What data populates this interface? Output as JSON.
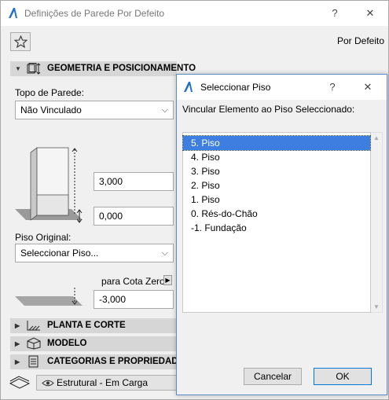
{
  "main": {
    "title": "Definições de Parede Por Defeito",
    "help": "?",
    "close": "✕",
    "favorites_icon": "star-icon",
    "defaults_label": "Por Defeito",
    "geometry": {
      "header": "GEOMETRIA E POSICIONAMENTO",
      "top_label": "Topo de Parede:",
      "top_value": "Não Vinculado",
      "height_value": "3,000",
      "offset_value": "0,000",
      "home_story_label": "Piso Original:",
      "home_story_value": "Seleccionar Piso...",
      "zero_ref_label": "para Cota Zero",
      "base_offset_value": "-3,000"
    },
    "sections": [
      {
        "label": "PLANTA E CORTE",
        "icon": "floor-plan-icon"
      },
      {
        "label": "MODELO",
        "icon": "model-cube-icon"
      },
      {
        "label": "CATEGORIAS E PROPRIEDADES",
        "icon": "properties-list-icon"
      }
    ],
    "layer_value": "Estrutural - Em Carga"
  },
  "dialog": {
    "title": "Seleccionar Piso",
    "help": "?",
    "close": "✕",
    "prompt": "Vincular Elemento ao Piso Seleccionado:",
    "stories": [
      "5. Piso",
      "4. Piso",
      "3. Piso",
      "2. Piso",
      "1. Piso",
      "0. Rés-do-Chão",
      "-1. Fundação"
    ],
    "selected_index": 0,
    "cancel_label": "Cancelar",
    "ok_label": "OK"
  },
  "colors": {
    "selection": "#3d7ee0",
    "section_header": "#d6d6d6",
    "dialog_border": "#5b8ccc"
  }
}
